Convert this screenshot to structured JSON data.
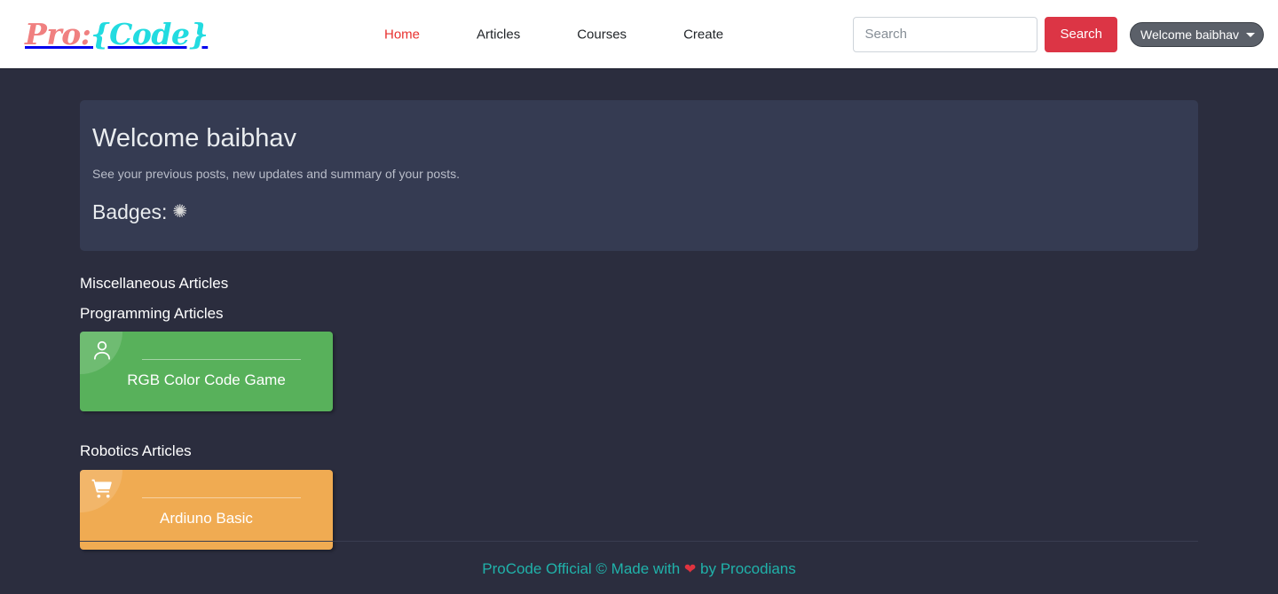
{
  "brand": {
    "pro": "Pro:",
    "code": "{Code}"
  },
  "nav": {
    "links": [
      {
        "label": "Home",
        "active": true
      },
      {
        "label": "Articles",
        "active": false
      },
      {
        "label": "Courses",
        "active": false
      },
      {
        "label": "Create",
        "active": false
      }
    ]
  },
  "search": {
    "placeholder": "Search",
    "value": "",
    "button_label": "Search"
  },
  "user_menu": {
    "label": "Welcome baibhav",
    "options": [
      "Welcome baibhav"
    ]
  },
  "jumbotron": {
    "title": "Welcome baibhav",
    "lead": "See your previous posts, new updates and summary of your posts.",
    "badges_label": "Badges:",
    "badge_glyph": "✺"
  },
  "sections": [
    {
      "title": "Miscellaneous Articles",
      "cards": []
    },
    {
      "title": "Programming Articles",
      "cards": [
        {
          "title": "RGB Color Code Game",
          "color": "#58b15b",
          "icon": "user-icon"
        }
      ]
    },
    {
      "title": "Robotics Articles",
      "cards": [
        {
          "title": "Ardiuno Basic",
          "color": "#f0ab52",
          "icon": "cart-icon"
        }
      ]
    }
  ],
  "footer": {
    "text_before": "ProCode Official © Made with",
    "heart": "❤",
    "text_after": "by Procodians"
  },
  "colors": {
    "page_bg": "#2b2d3e",
    "jumbotron_bg": "#353b52",
    "brand_pro": "#f08080",
    "brand_code": "#22dbe0",
    "nav_active": "#e8302e",
    "search_button": "#dc3545",
    "footer_text": "#20b2aa",
    "card_green": "#58b15b",
    "card_orange": "#f0ab52"
  }
}
